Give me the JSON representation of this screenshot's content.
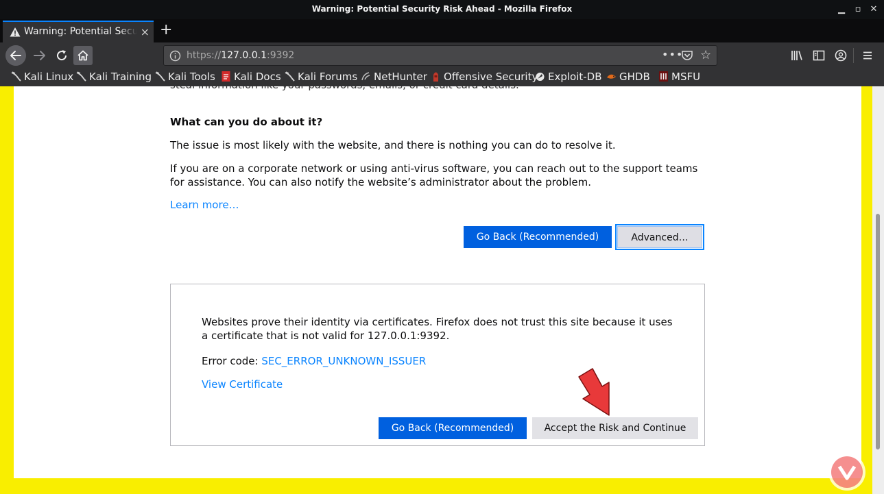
{
  "window": {
    "title": "Warning: Potential Security Risk Ahead - Mozilla Firefox",
    "min_icon": "minimize-icon",
    "max_icon": "maximize-icon",
    "close_icon": "close-icon"
  },
  "tabs": [
    {
      "title": "Warning: Potential Security Risk Ahead",
      "icon": "warning-icon",
      "close": "×"
    }
  ],
  "new_tab_label": "+",
  "urlbar": {
    "scheme": "https://",
    "host": "127.0.0.1",
    "port": ":9392",
    "menu": "•••"
  },
  "bookmarks": [
    {
      "label": "Kali Linux",
      "icon": "kali-dragon-icon"
    },
    {
      "label": "Kali Training",
      "icon": "kali-dragon-icon"
    },
    {
      "label": "Kali Tools",
      "icon": "kali-dragon-icon"
    },
    {
      "label": "Kali Docs",
      "icon": "kali-docs-icon"
    },
    {
      "label": "Kali Forums",
      "icon": "kali-dragon-icon"
    },
    {
      "label": "NetHunter",
      "icon": "nethunter-icon"
    },
    {
      "label": "Offensive Security",
      "icon": "offsec-icon"
    },
    {
      "label": "Exploit-DB",
      "icon": "exploitdb-icon"
    },
    {
      "label": "GHDB",
      "icon": "ghdb-icon"
    },
    {
      "label": "MSFU",
      "icon": "msfu-icon"
    }
  ],
  "page": {
    "cut_text": "steal information like your passwords, emails, or credit card details.",
    "heading": "What can you do about it?",
    "para1": "The issue is most likely with the website, and there is nothing you can do to resolve it.",
    "para2": "If you are on a corporate network or using anti-virus software, you can reach out to the support teams for assistance. You can also notify the website’s administrator about the problem.",
    "learn_more": "Learn more…",
    "go_back": "Go Back (Recommended)",
    "advanced": "Advanced…",
    "advanced_panel": {
      "text": "Websites prove their identity via certificates. Firefox does not trust this site because it uses a certificate that is not valid for 127.0.0.1:9392.",
      "error_label": "Error code: ",
      "error_code": "SEC_ERROR_UNKNOWN_ISSUER",
      "view_certificate": "View Certificate",
      "go_back": "Go Back (Recommended)",
      "accept": "Accept the Risk and Continue"
    }
  },
  "colors": {
    "highlight_border": "#f9ee00",
    "primary_button": "#0060df",
    "link": "#0a84ff",
    "pointer_arrow": "#e8393a"
  }
}
